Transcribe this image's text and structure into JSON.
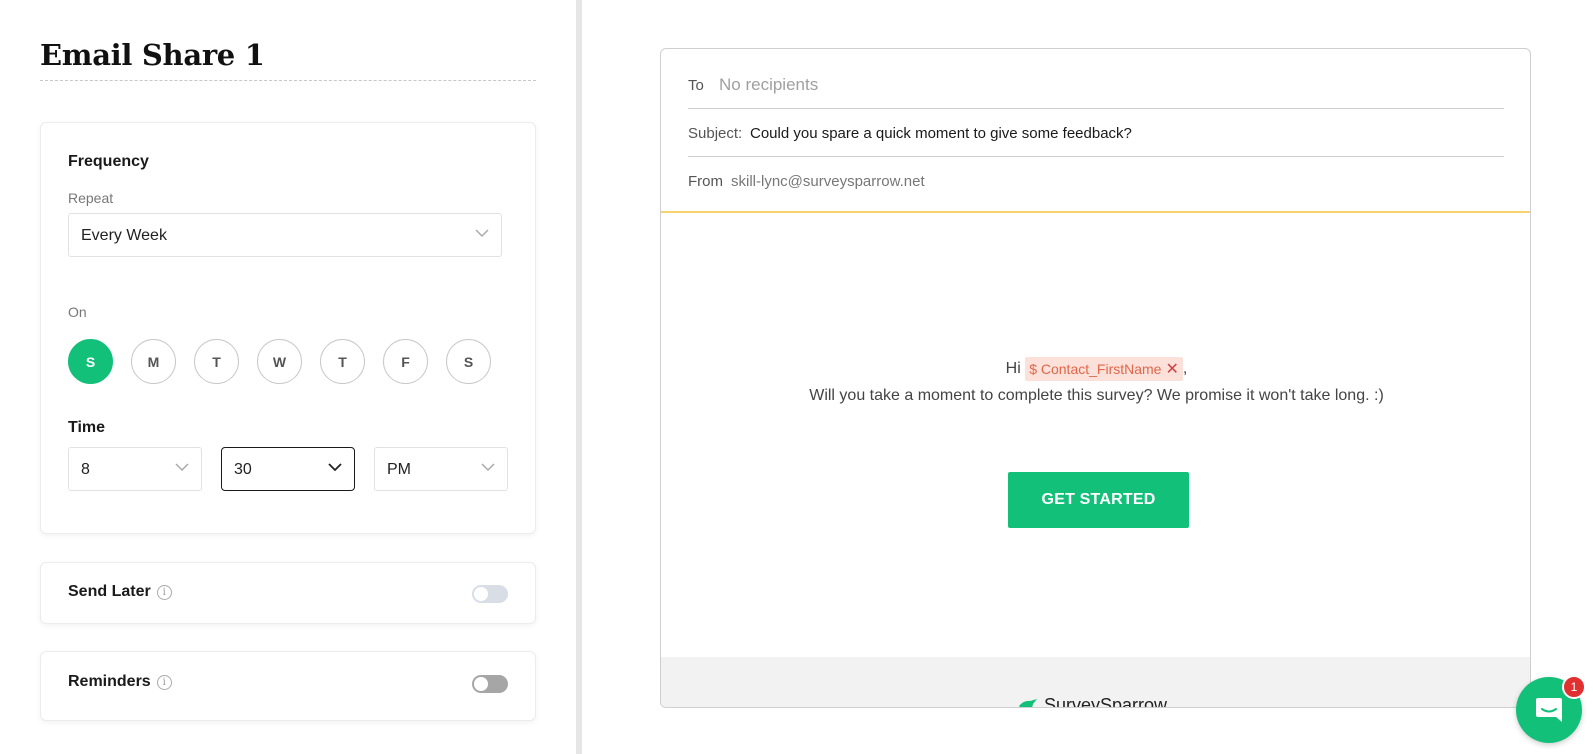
{
  "left_panel": {
    "title": "Email Share 1",
    "frequency": {
      "heading": "Frequency",
      "repeat_label": "Repeat",
      "repeat_value": "Every Week",
      "on_label": "On",
      "days": [
        {
          "label": "S",
          "selected": true
        },
        {
          "label": "M",
          "selected": false
        },
        {
          "label": "T",
          "selected": false
        },
        {
          "label": "W",
          "selected": false
        },
        {
          "label": "T",
          "selected": false
        },
        {
          "label": "F",
          "selected": false
        },
        {
          "label": "S",
          "selected": false
        }
      ],
      "time_label": "Time",
      "hour": "8",
      "minute": "30",
      "meridiem": "PM"
    },
    "send_later": {
      "label": "Send Later",
      "info_icon": "info-icon",
      "enabled": false
    },
    "reminders": {
      "label": "Reminders",
      "info_icon": "info-icon",
      "enabled": false
    }
  },
  "email_preview": {
    "to_label": "To",
    "to_value": "No recipients",
    "subject_label": "Subject:",
    "subject_value": "Could you spare a quick moment to give some feedback?",
    "from_label": "From",
    "from_value": "skill-lync@surveysparrow.net",
    "greeting_prefix": "Hi",
    "merge_tag": "$ Contact_FirstName",
    "greeting_suffix": ",",
    "body_text": "Will you take a moment to complete this survey? We promise it won't take long. :)",
    "cta_label": "GET STARTED",
    "brand_name": "SurveySparrow"
  },
  "chat_widget": {
    "badge_count": "1"
  },
  "colors": {
    "accent_green": "#13c07a",
    "divider_yellow": "#f6d46b",
    "tag_bg": "#fbe1d9",
    "tag_text": "#e0674b",
    "badge_red": "#e03030"
  }
}
